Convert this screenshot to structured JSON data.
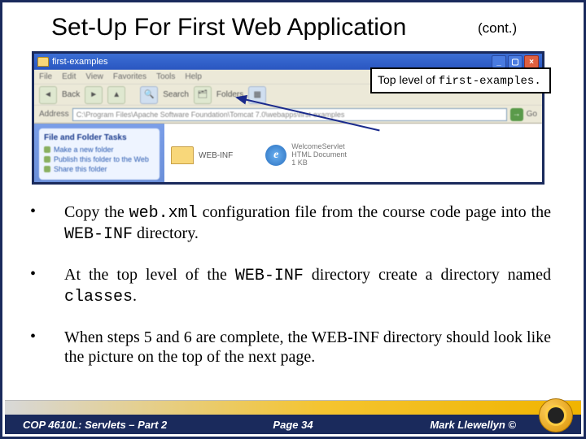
{
  "title": "Set-Up For First Web Application",
  "cont": "(cont.)",
  "callout": {
    "pre": "Top level of ",
    "code": "first-examples."
  },
  "explorer": {
    "title": "first-examples",
    "menu": [
      "File",
      "Edit",
      "View",
      "Favorites",
      "Tools",
      "Help"
    ],
    "tool": {
      "back": "Back",
      "search": "Search",
      "folders": "Folders"
    },
    "addrlabel": "Address",
    "addrpath": "C:\\Program Files\\Apache Software Foundation\\Tomcat 7.0\\webapps\\first-examples",
    "go": "Go",
    "tasks": {
      "head": "File and Folder Tasks",
      "i1": "Make a new folder",
      "i2": "Publish this folder to the Web",
      "i3": "Share this folder"
    },
    "files": {
      "webinf": "WEB-INF",
      "ws_name": "WelcomeServlet",
      "ws_type": "HTML Document",
      "ws_size": "1 KB"
    }
  },
  "bullets": {
    "b1a": "Copy the ",
    "b1code1": "web.xml",
    "b1b": " configuration file from the course code page into the ",
    "b1code2": "WEB-INF",
    "b1c": " directory.",
    "b2a": "At the top level of the ",
    "b2code1": "WEB-INF",
    "b2b": " directory create a directory named ",
    "b2code2": "classes",
    "b2c": ".",
    "b3": "When steps 5 and 6 are complete, the WEB-INF directory should look like the picture on the top of the next page."
  },
  "footer": {
    "left": "COP 4610L: Servlets – Part 2",
    "center": "Page 34",
    "right": "Mark Llewellyn ©"
  }
}
